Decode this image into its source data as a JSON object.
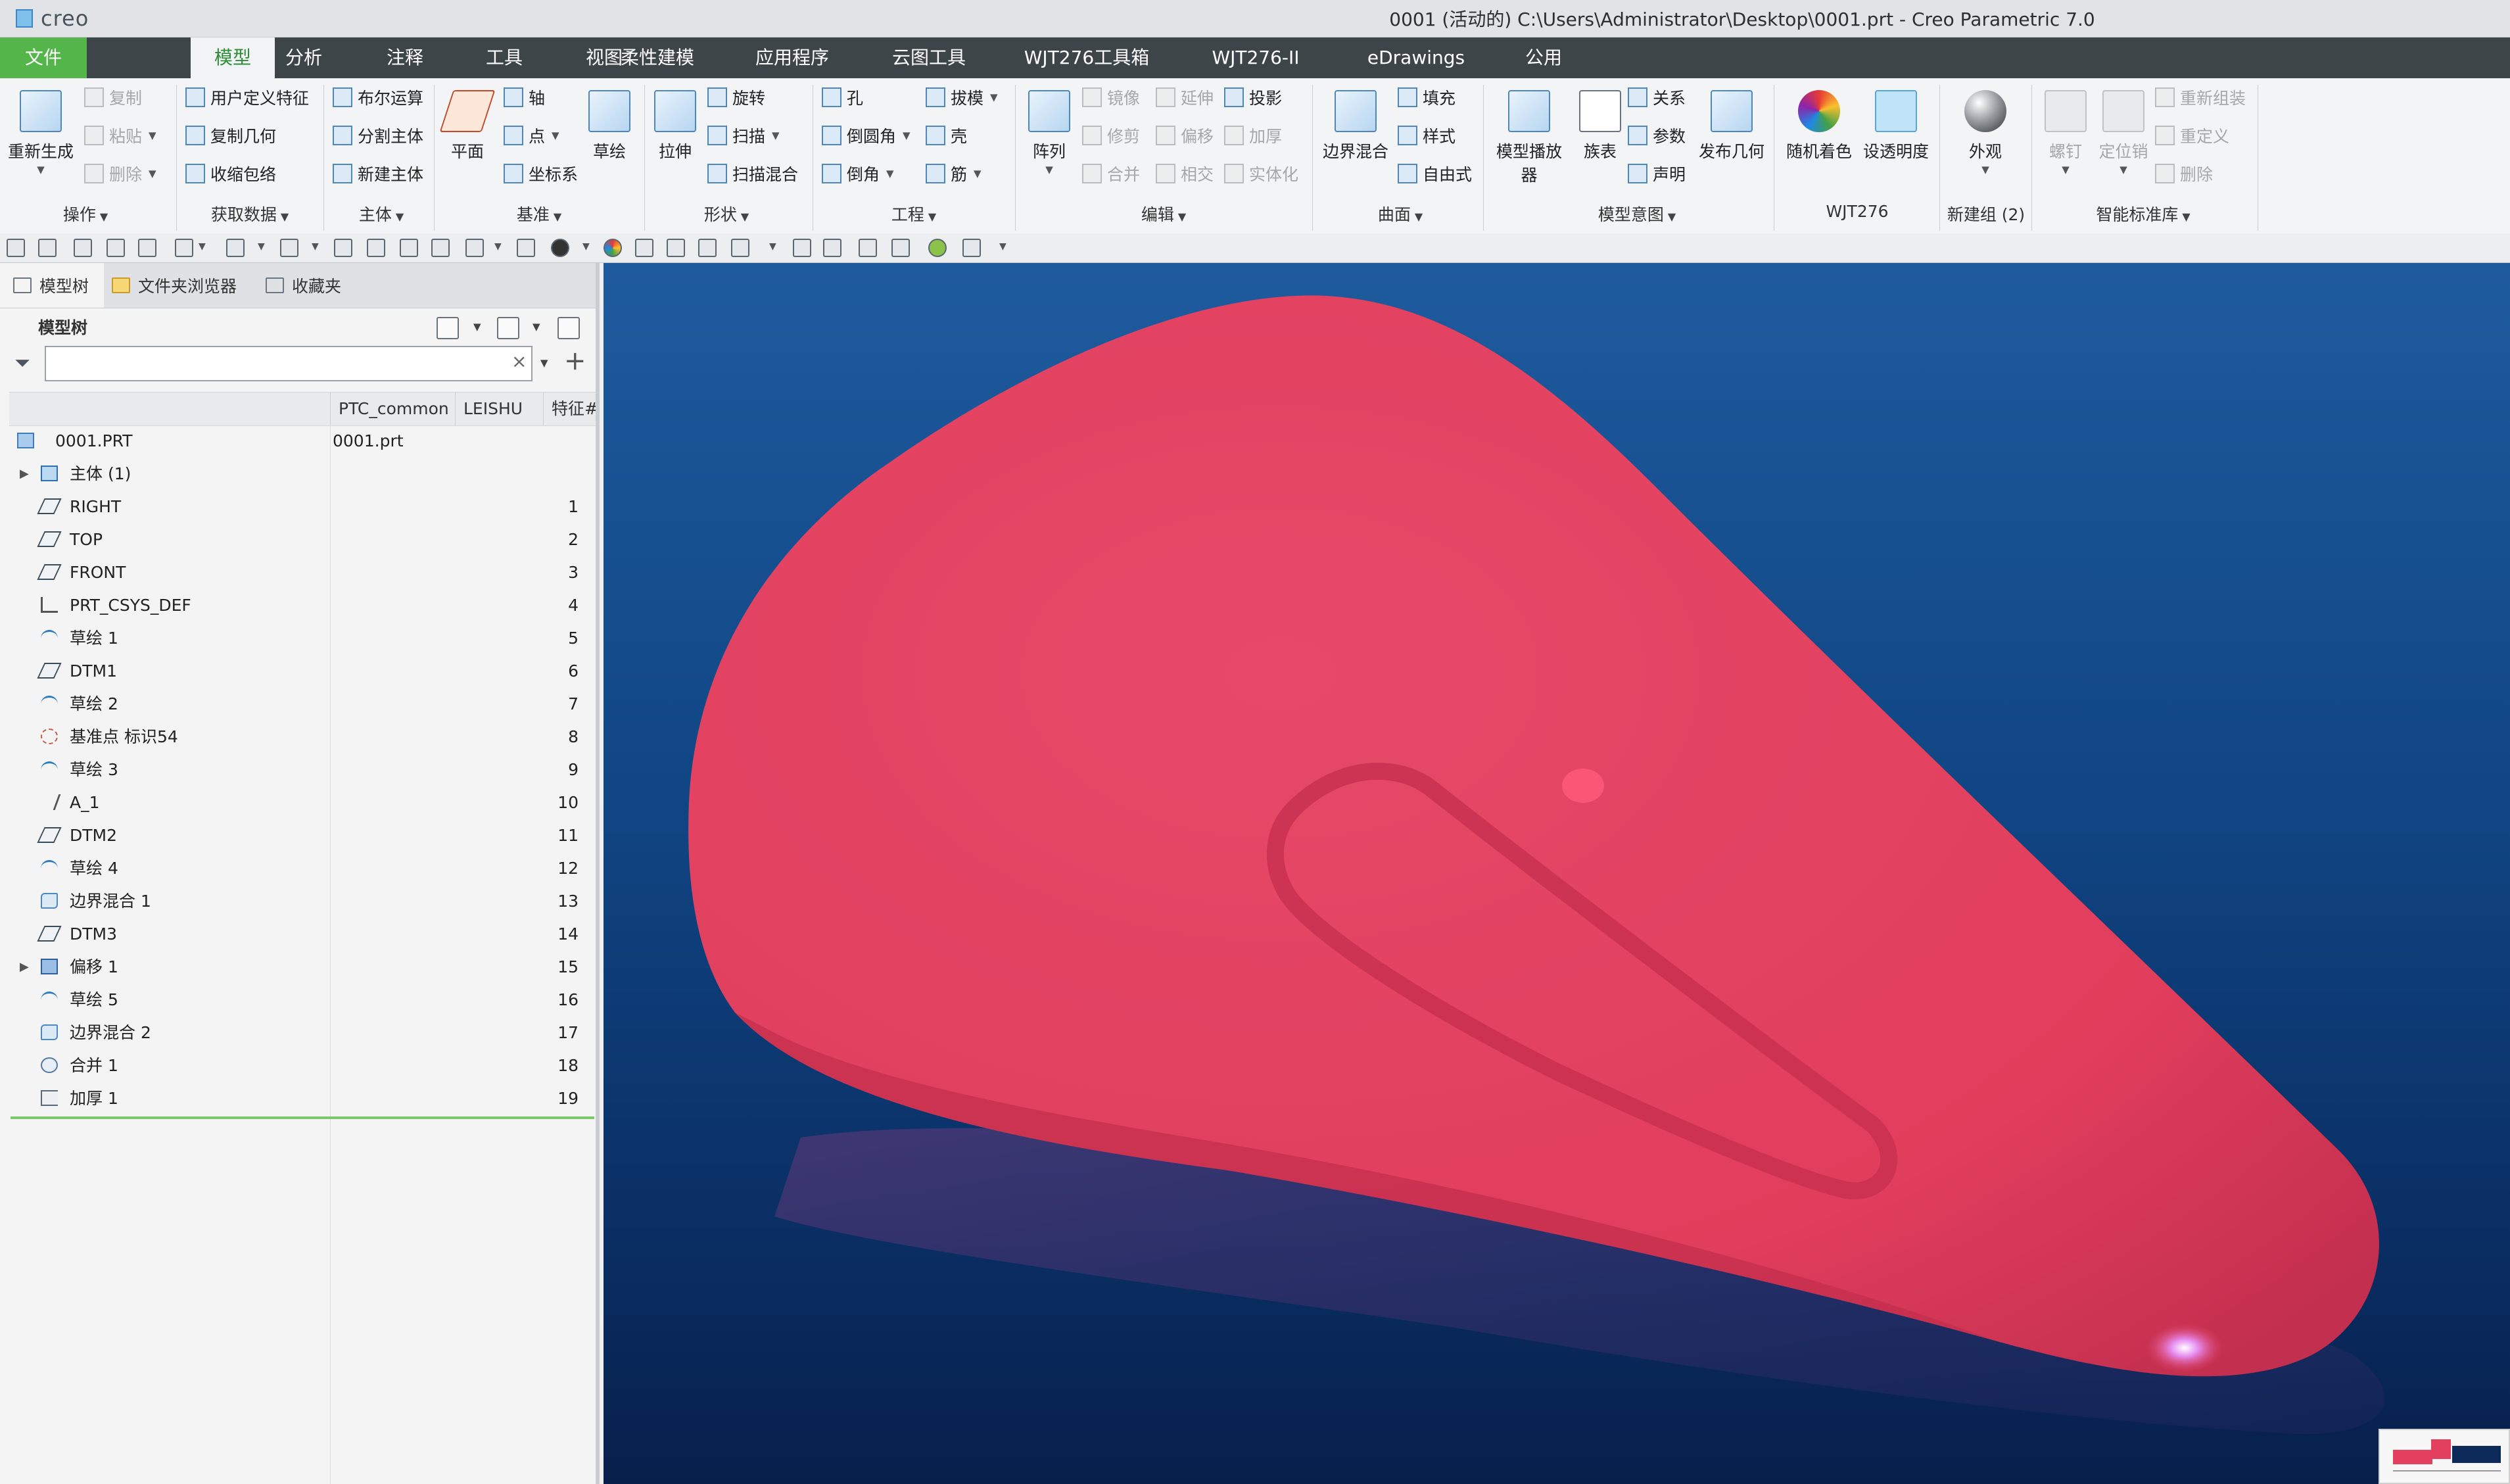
{
  "titlebar": {
    "app_logo": "creo",
    "window_title": "0001 (活动的) C:\\Users\\Administrator\\Desktop\\0001.prt - Creo Parametric 7.0"
  },
  "ribbon_tabs": [
    "文件",
    "模型",
    "分析",
    "注释",
    "工具",
    "视图",
    "柔性建模",
    "应用程序",
    "云图工具",
    "WJT276工具箱",
    "WJT276-II",
    "eDrawings",
    "公用"
  ],
  "active_tab": "模型",
  "ribbon": {
    "operations": {
      "label": "操作",
      "regenerate": "重新生成",
      "copy": "复制",
      "paste": "粘贴",
      "delete": "删除"
    },
    "get_data": {
      "label": "获取数据",
      "udf": "用户定义特征",
      "copy_geom": "复制几何",
      "shrinkwrap": "收缩包络"
    },
    "body": {
      "label": "主体",
      "boolean": "布尔运算",
      "split_body": "分割主体",
      "new_body": "新建主体"
    },
    "datum": {
      "label": "基准",
      "plane": "平面",
      "axis": "轴",
      "point": "点",
      "csys": "坐标系",
      "sketch": "草绘"
    },
    "shapes": {
      "label": "形状",
      "extrude": "拉伸",
      "revolve": "旋转",
      "sweep": "扫描",
      "swept_blend": "扫描混合"
    },
    "engineering": {
      "label": "工程",
      "hole": "孔",
      "round": "倒圆角",
      "chamfer": "倒角",
      "draft": "拔模",
      "shell": "壳",
      "rib": "筋"
    },
    "editing": {
      "label": "编辑",
      "pattern": "阵列",
      "mirror": "镜像",
      "trim": "修剪",
      "merge": "合并",
      "extend": "延伸",
      "offset": "偏移",
      "intersect": "相交",
      "project": "投影",
      "thicken": "加厚",
      "solidify": "实体化"
    },
    "surfaces": {
      "label": "曲面",
      "boundary_blend": "边界混合",
      "fill": "填充",
      "style": "样式",
      "freestyle": "自由式"
    },
    "model_intent": {
      "label": "模型意图",
      "model_player": "模型播放器",
      "family_table": "族表",
      "relations": "关系",
      "parameters": "参数",
      "declare": "声明",
      "publish_geom": "发布几何"
    },
    "wjt276": {
      "label": "WJT276",
      "random_color": "随机着色",
      "set_transparency": "设透明度"
    },
    "new_group": {
      "label": "新建组 (2)",
      "appearance": "外观"
    },
    "smart_lib": {
      "label": "智能标准库",
      "screw": "螺钉",
      "pin": "定位销",
      "reassemble": "重新组装",
      "redefine": "重定义",
      "delete": "删除"
    }
  },
  "panel_tabs": [
    "模型树",
    "文件夹浏览器",
    "收藏夹"
  ],
  "tree": {
    "title": "模型树",
    "search_value": "",
    "columns": [
      "PTC_common",
      "LEISHU",
      "特征#"
    ],
    "items": [
      {
        "name": "0001.PRT",
        "common": "0001.prt",
        "num": "",
        "icon": "part-icon",
        "expandable": false
      },
      {
        "name": "主体 (1)",
        "common": "",
        "num": "",
        "icon": "body-icon",
        "expandable": true
      },
      {
        "name": "RIGHT",
        "common": "",
        "num": "1",
        "icon": "datum-plane-icon",
        "expandable": false
      },
      {
        "name": "TOP",
        "common": "",
        "num": "2",
        "icon": "datum-plane-icon",
        "expandable": false
      },
      {
        "name": "FRONT",
        "common": "",
        "num": "3",
        "icon": "datum-plane-icon",
        "expandable": false
      },
      {
        "name": "PRT_CSYS_DEF",
        "common": "",
        "num": "4",
        "icon": "csys-icon",
        "expandable": false
      },
      {
        "name": "草绘 1",
        "common": "",
        "num": "5",
        "icon": "sketch-icon",
        "expandable": false
      },
      {
        "name": "DTM1",
        "common": "",
        "num": "6",
        "icon": "datum-plane-icon",
        "expandable": false
      },
      {
        "name": "草绘 2",
        "common": "",
        "num": "7",
        "icon": "sketch-icon",
        "expandable": false
      },
      {
        "name": "基准点 标识54",
        "common": "",
        "num": "8",
        "icon": "datum-point-icon",
        "expandable": false
      },
      {
        "name": "草绘 3",
        "common": "",
        "num": "9",
        "icon": "sketch-icon",
        "expandable": false
      },
      {
        "name": "A_1",
        "common": "",
        "num": "10",
        "icon": "axis-icon",
        "expandable": false
      },
      {
        "name": "DTM2",
        "common": "",
        "num": "11",
        "icon": "datum-plane-icon",
        "expandable": false
      },
      {
        "name": "草绘 4",
        "common": "",
        "num": "12",
        "icon": "sketch-icon",
        "expandable": false
      },
      {
        "name": "边界混合 1",
        "common": "",
        "num": "13",
        "icon": "boundary-blend-icon",
        "expandable": false
      },
      {
        "name": "DTM3",
        "common": "",
        "num": "14",
        "icon": "datum-plane-icon",
        "expandable": false
      },
      {
        "name": "偏移 1",
        "common": "",
        "num": "15",
        "icon": "offset-icon",
        "expandable": true
      },
      {
        "name": "草绘 5",
        "common": "",
        "num": "16",
        "icon": "sketch-icon",
        "expandable": false
      },
      {
        "name": "边界混合 2",
        "common": "",
        "num": "17",
        "icon": "boundary-blend-icon",
        "expandable": false
      },
      {
        "name": "合并 1",
        "common": "",
        "num": "18",
        "icon": "merge-icon",
        "expandable": false
      },
      {
        "name": "加厚 1",
        "common": "",
        "num": "19",
        "icon": "thicken-icon",
        "expandable": false
      }
    ]
  },
  "colors": {
    "model": "#e33f5e",
    "background_top": "#1e5b9e",
    "background_bottom": "#071f4b",
    "file_tab": "#54b64a",
    "tree_end_line": "#7bc56b"
  }
}
